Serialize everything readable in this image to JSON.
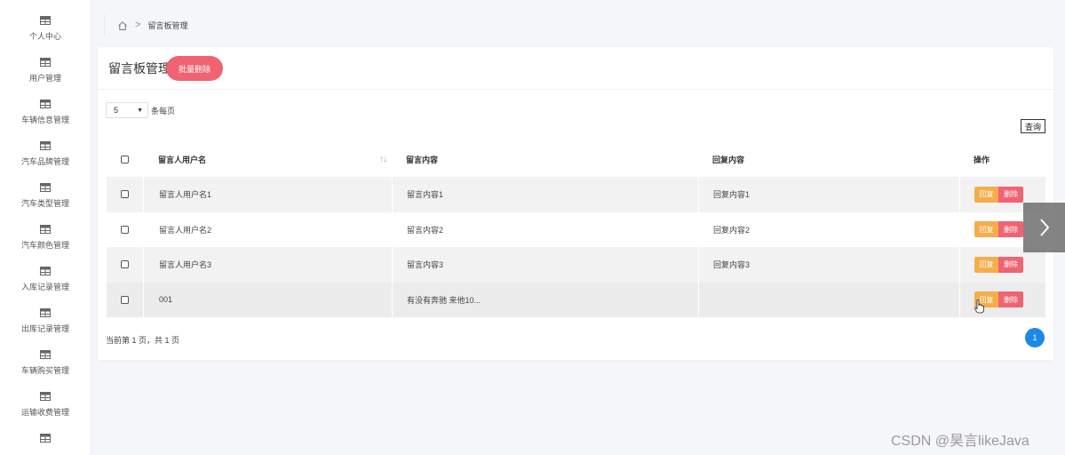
{
  "sidebar": {
    "items": [
      {
        "label": "个人中心",
        "icon": "grid-icon"
      },
      {
        "label": "用户管理",
        "icon": "grid-icon"
      },
      {
        "label": "车辆信息管理",
        "icon": "grid-icon"
      },
      {
        "label": "汽车品牌管理",
        "icon": "grid-icon"
      },
      {
        "label": "汽车类型管理",
        "icon": "grid-icon"
      },
      {
        "label": "汽车颜色管理",
        "icon": "grid-icon"
      },
      {
        "label": "入库记录管理",
        "icon": "grid-icon"
      },
      {
        "label": "出库记录管理",
        "icon": "grid-icon"
      },
      {
        "label": "车辆购买管理",
        "icon": "grid-icon"
      },
      {
        "label": "运输收费管理",
        "icon": "grid-icon"
      },
      {
        "label": "",
        "icon": "grid-icon"
      }
    ]
  },
  "breadcrumb": {
    "current": "留言板管理",
    "separator": ">"
  },
  "card": {
    "title": "留言板管理",
    "batch_delete_label": "批量删除",
    "page_size_value": "5",
    "page_size_suffix": "条每页",
    "query_label": "查询"
  },
  "table": {
    "headers": [
      "留言人用户名",
      "留言内容",
      "回复内容",
      "操作"
    ],
    "sort_icon": "↑↓",
    "rows": [
      {
        "username": "留言人用户名1",
        "content": "留言内容1",
        "reply": "回复内容1"
      },
      {
        "username": "留言人用户名2",
        "content": "留言内容2",
        "reply": "回复内容2"
      },
      {
        "username": "留言人用户名3",
        "content": "留言内容3",
        "reply": "回复内容3"
      },
      {
        "username": "001",
        "content": "有没有奔驰 来他10...",
        "reply": ""
      }
    ],
    "reply_label": "回复",
    "delete_label": "删除"
  },
  "pagination": {
    "info": "当前第 1 页，共 1 页",
    "current_page": "1"
  },
  "watermark": "CSDN @昊言likeJava",
  "colors": {
    "danger": "#f06373",
    "warning": "#f5ad4b",
    "primary": "#1e88e5"
  }
}
